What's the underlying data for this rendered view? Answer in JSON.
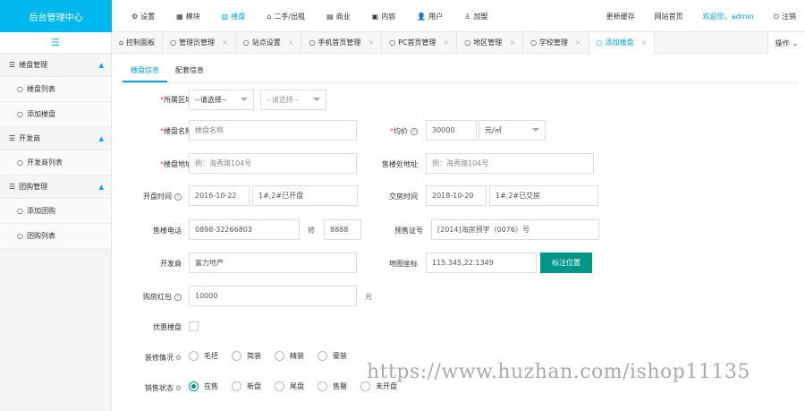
{
  "brand": "后台管理中心",
  "topnav": [
    {
      "icon": "⚙",
      "label": "设置"
    },
    {
      "icon": "▦",
      "label": "模块"
    },
    {
      "icon": "▥",
      "label": "楼盘"
    },
    {
      "icon": "⌂",
      "label": "二手/出租"
    },
    {
      "icon": "▤",
      "label": "商业"
    },
    {
      "icon": "▣",
      "label": "内容"
    },
    {
      "icon": "👤",
      "label": "用户"
    },
    {
      "icon": "♙",
      "label": "加盟"
    }
  ],
  "topright": {
    "cache": "更新缓存",
    "home": "网站首页",
    "welcome": "欢迎您，admin",
    "logout_icon": "⏻",
    "logout": "注销"
  },
  "sidebar": {
    "toggle_icon": "☰",
    "groups": [
      {
        "label": "楼盘管理",
        "items": [
          "楼盘列表",
          "添加楼盘"
        ]
      },
      {
        "label": "开发商",
        "items": [
          "开发商列表"
        ]
      },
      {
        "label": "团购管理",
        "items": [
          "添加团购",
          "团购列表"
        ]
      }
    ]
  },
  "tabs": [
    {
      "icon": "⌂",
      "label": "控制面板"
    },
    {
      "icon": "○",
      "label": "管理员管理"
    },
    {
      "icon": "○",
      "label": "站点设置"
    },
    {
      "icon": "○",
      "label": "手机首页管理"
    },
    {
      "icon": "○",
      "label": "PC首页管理"
    },
    {
      "icon": "○",
      "label": "地区管理"
    },
    {
      "icon": "○",
      "label": "学校管理"
    },
    {
      "icon": "○",
      "label": "添加楼盘"
    }
  ],
  "tab_close": "×",
  "operation": "操作",
  "subtabs": [
    "楼盘信息",
    "配套信息"
  ],
  "form": {
    "area_label": "所属区域",
    "area_select1": "--请选择--",
    "area_select2": "--请选择--",
    "name_label": "楼盘名称",
    "name_placeholder": "楼盘名称",
    "price_label": "均价",
    "price_value": "30000",
    "price_unit": "元/㎡",
    "addr_label": "楼盘地址",
    "addr_placeholder": "例：海秀路104号",
    "sales_addr_label": "售楼处地址",
    "sales_addr_placeholder": "例：海秀路104号",
    "open_label": "开盘时间",
    "open_date": "2016-10-22",
    "open_note": "1#,2#已开盘",
    "deliver_label": "交房时间",
    "deliver_date": "2018-10-20",
    "deliver_note": "1#,2#已交房",
    "phone_label": "售楼电话",
    "phone_value": "0898-32266803",
    "ext_label": "转",
    "ext_value": "8888",
    "permit_label": "预售证号",
    "permit_value": "[2014]海房预字（0076）号",
    "dev_label": "开发商",
    "dev_value": "富力地产",
    "coord_label": "地图坐标",
    "coord_value": "115.345,22.1349",
    "coord_button": "标注位置",
    "redpack_label": "购房红包",
    "redpack_value": "10000",
    "redpack_unit": "元",
    "discount_label": "优惠楼盘",
    "decor_label": "装修情况",
    "decor_options": [
      "毛坯",
      "简装",
      "精装",
      "豪装"
    ],
    "status_label": "销售状态",
    "status_options": [
      "在售",
      "新盘",
      "尾盘",
      "售罄",
      "未开盘"
    ],
    "status_selected": "在售"
  },
  "watermark": "https://www.huzhan.com/ishop11135"
}
